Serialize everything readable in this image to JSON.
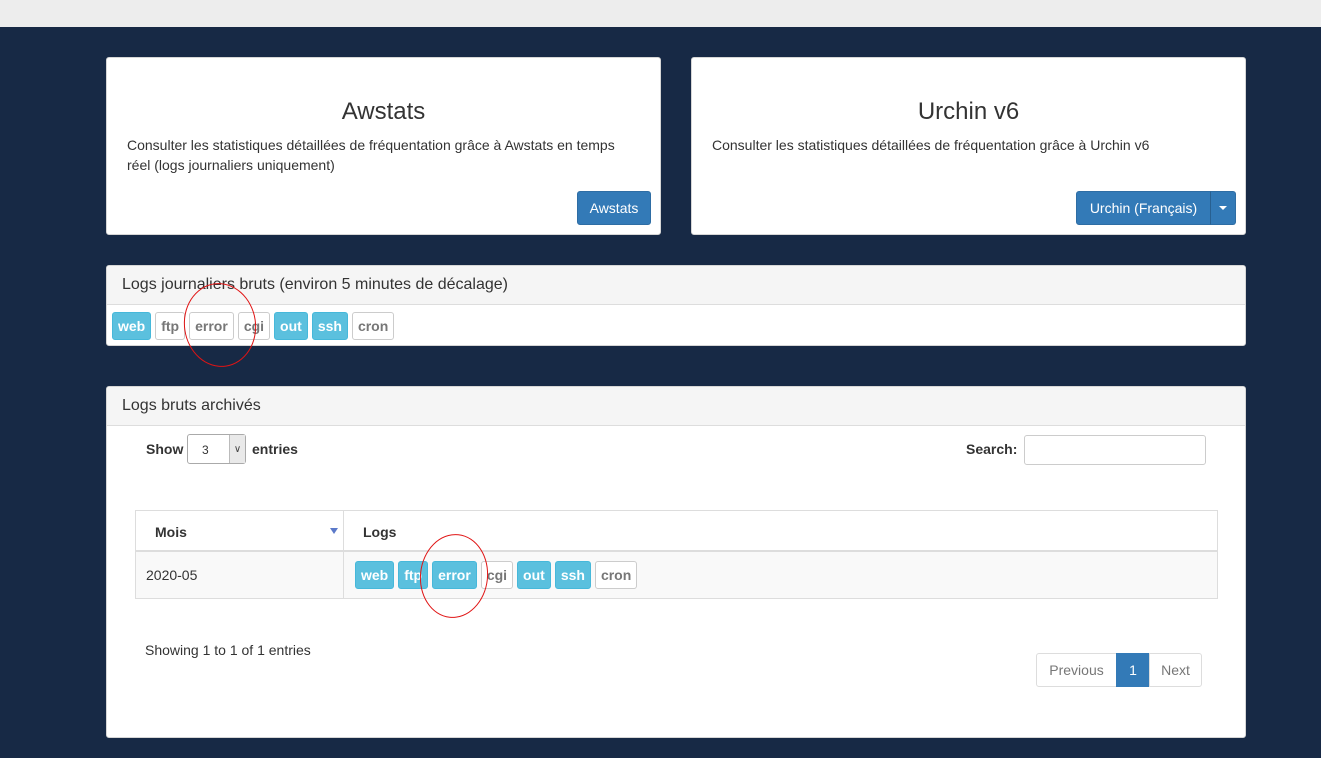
{
  "awstats": {
    "title": "Awstats",
    "description": "Consulter les statistiques détaillées de fréquentation grâce à Awstats en temps réel (logs journaliers uniquement)",
    "button_label": "Awstats"
  },
  "urchin": {
    "title": "Urchin v6",
    "description": "Consulter les statistiques détaillées de fréquentation grâce à Urchin v6",
    "button_label": "Urchin (Français)"
  },
  "daily_logs": {
    "heading": "Logs journaliers bruts (environ 5 minutes de décalage)",
    "tags": [
      {
        "label": "web",
        "active": true
      },
      {
        "label": "ftp",
        "active": false
      },
      {
        "label": "error",
        "active": false
      },
      {
        "label": "cgi",
        "active": false
      },
      {
        "label": "out",
        "active": true
      },
      {
        "label": "ssh",
        "active": true
      },
      {
        "label": "cron",
        "active": false
      }
    ]
  },
  "archived_logs": {
    "heading": "Logs bruts archivés",
    "show_label": "Show",
    "entries_label": "entries",
    "page_length": "3",
    "search_label": "Search:",
    "search_value": "",
    "columns": [
      "Mois",
      "Logs"
    ],
    "rows": [
      {
        "month": "2020-05",
        "tags": [
          {
            "label": "web",
            "active": true
          },
          {
            "label": "ftp",
            "active": true
          },
          {
            "label": "error",
            "active": true
          },
          {
            "label": "cgi",
            "active": false
          },
          {
            "label": "out",
            "active": true
          },
          {
            "label": "ssh",
            "active": true
          },
          {
            "label": "cron",
            "active": false
          }
        ]
      }
    ],
    "info": "Showing 1 to 1 of 1 entries",
    "pagination": {
      "previous": "Previous",
      "current": "1",
      "next": "Next"
    }
  },
  "colors": {
    "page_background": "#172945",
    "primary": "#337ab7",
    "tag_active": "#5bc0de",
    "annotation": "#e01414"
  }
}
